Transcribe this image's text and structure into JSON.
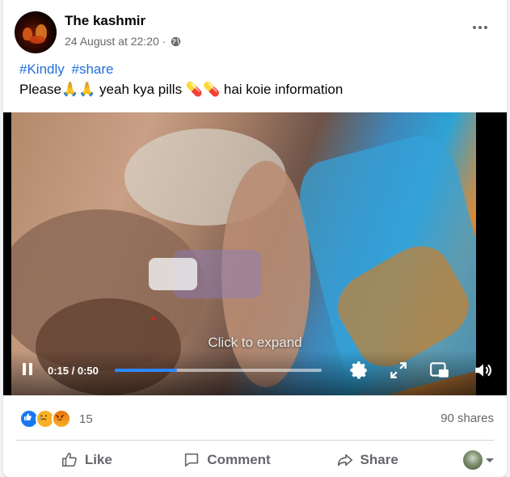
{
  "post": {
    "page_name": "The kashmir",
    "timestamp": "24 August at 22:20",
    "separator": "·",
    "audience_icon": "globe-icon",
    "more_icon": "more-options-icon",
    "hashtags": [
      "#Kindly",
      "#share"
    ],
    "text": "Please🙏🙏 yeah kya pills 💊💊 hai koie information"
  },
  "video": {
    "overlay_hint": "Click to expand",
    "current_time": "0:15",
    "duration": "0:50",
    "time_display": "0:15 / 0:50",
    "progress_fraction": 0.3,
    "accent_color": "#2d88ff",
    "controls": [
      "pause-icon",
      "settings-gear-icon",
      "fullscreen-icon",
      "picture-in-picture-icon",
      "volume-icon"
    ]
  },
  "stats": {
    "reaction_icons": [
      "like-reaction-icon",
      "sad-reaction-icon",
      "angry-reaction-icon"
    ],
    "reaction_count": "15",
    "shares": "90 shares"
  },
  "actions": {
    "like": "Like",
    "comment": "Comment",
    "share": "Share"
  },
  "colors": {
    "link": "#216fdb",
    "secondary_text": "#65676b",
    "like_blue": "#1877f2"
  }
}
